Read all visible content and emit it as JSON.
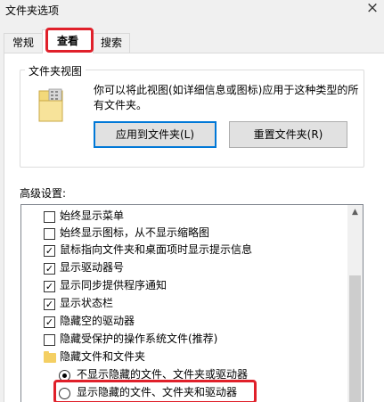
{
  "window": {
    "title": "文件夹选项",
    "close_icon": "×"
  },
  "tabs": [
    {
      "label": "常规",
      "active": false
    },
    {
      "label": "查看",
      "active": true
    },
    {
      "label": "搜索",
      "active": false
    }
  ],
  "folder_views": {
    "title": "文件夹视图",
    "description": "你可以将此视图(如详细信息或图标)应用于这种类型的所有文件夹。",
    "apply_button": "应用到文件夹(L)",
    "reset_button": "重置文件夹(R)"
  },
  "advanced": {
    "label": "高级设置:",
    "items": [
      {
        "type": "checkbox",
        "label": "始终显示菜单",
        "checked": false
      },
      {
        "type": "checkbox",
        "label": "始终显示图标，从不显示缩略图",
        "checked": false
      },
      {
        "type": "checkbox",
        "label": "鼠标指向文件夹和桌面项时显示提示信息",
        "checked": true
      },
      {
        "type": "checkbox",
        "label": "显示驱动器号",
        "checked": true
      },
      {
        "type": "checkbox",
        "label": "显示同步提供程序通知",
        "checked": true
      },
      {
        "type": "checkbox",
        "label": "显示状态栏",
        "checked": true
      },
      {
        "type": "checkbox",
        "label": "隐藏空的驱动器",
        "checked": true
      },
      {
        "type": "checkbox",
        "label": "隐藏受保护的操作系统文件(推荐)",
        "checked": false
      },
      {
        "type": "folder",
        "label": "隐藏文件和文件夹"
      },
      {
        "type": "radio",
        "label": "不显示隐藏的文件、文件夹或驱动器",
        "selected": true
      },
      {
        "type": "radio",
        "label": "显示隐藏的文件、文件夹和驱动器",
        "selected": false
      }
    ]
  },
  "colors": {
    "highlight": "#e0202a",
    "accent": "#0078d7"
  }
}
